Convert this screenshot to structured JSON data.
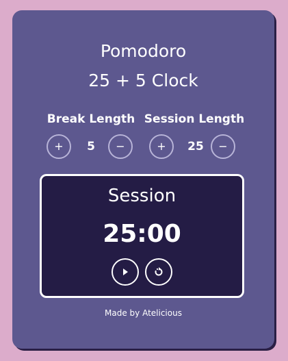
{
  "app": {
    "title_line1": "Pomodoro",
    "title_line2": "25 + 5 Clock"
  },
  "break": {
    "label": "Break Length",
    "value": "5",
    "increment_label": "+",
    "decrement_label": "−"
  },
  "session": {
    "label": "Session Length",
    "value": "25",
    "increment_label": "+",
    "decrement_label": "−"
  },
  "timer": {
    "label": "Session",
    "time": "25:00",
    "play_icon": "play-icon",
    "reset_icon": "reset-icon"
  },
  "footer": {
    "text": "Made by Atelicious"
  },
  "colors": {
    "page_background": "#dcaccb",
    "card_background": "#5d588f",
    "timer_background": "#241c45",
    "text": "#ffffff"
  }
}
